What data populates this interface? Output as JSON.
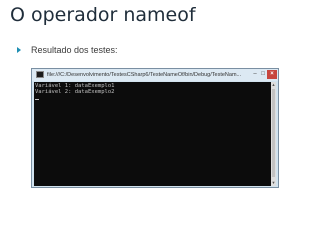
{
  "slide": {
    "title": "O operador nameof",
    "bullet_text": "Resultado dos testes:"
  },
  "window": {
    "title": "file:///C:/Desenvolvimento/TestesCSharp6/TesteNameOf/bin/Debug/TesteNam...",
    "minimize_glyph": "–",
    "maximize_glyph": "□",
    "close_glyph": "×",
    "console_lines": [
      "Variável 1: dataExemplo1",
      "Variável 2: dataExemplo2"
    ],
    "scroll_up_glyph": "▲",
    "scroll_down_glyph": "▼"
  },
  "colors": {
    "title_text": "#1f2d3a",
    "bullet_accent": "#1f8fb3",
    "console_background": "#0c0c0c",
    "console_text": "#c0c0c0",
    "titlebar": "#dce9f3",
    "close_button": "#c7463e"
  },
  "icons": {
    "bullet": "triangle-bullet-icon",
    "app": "console-app-icon"
  }
}
